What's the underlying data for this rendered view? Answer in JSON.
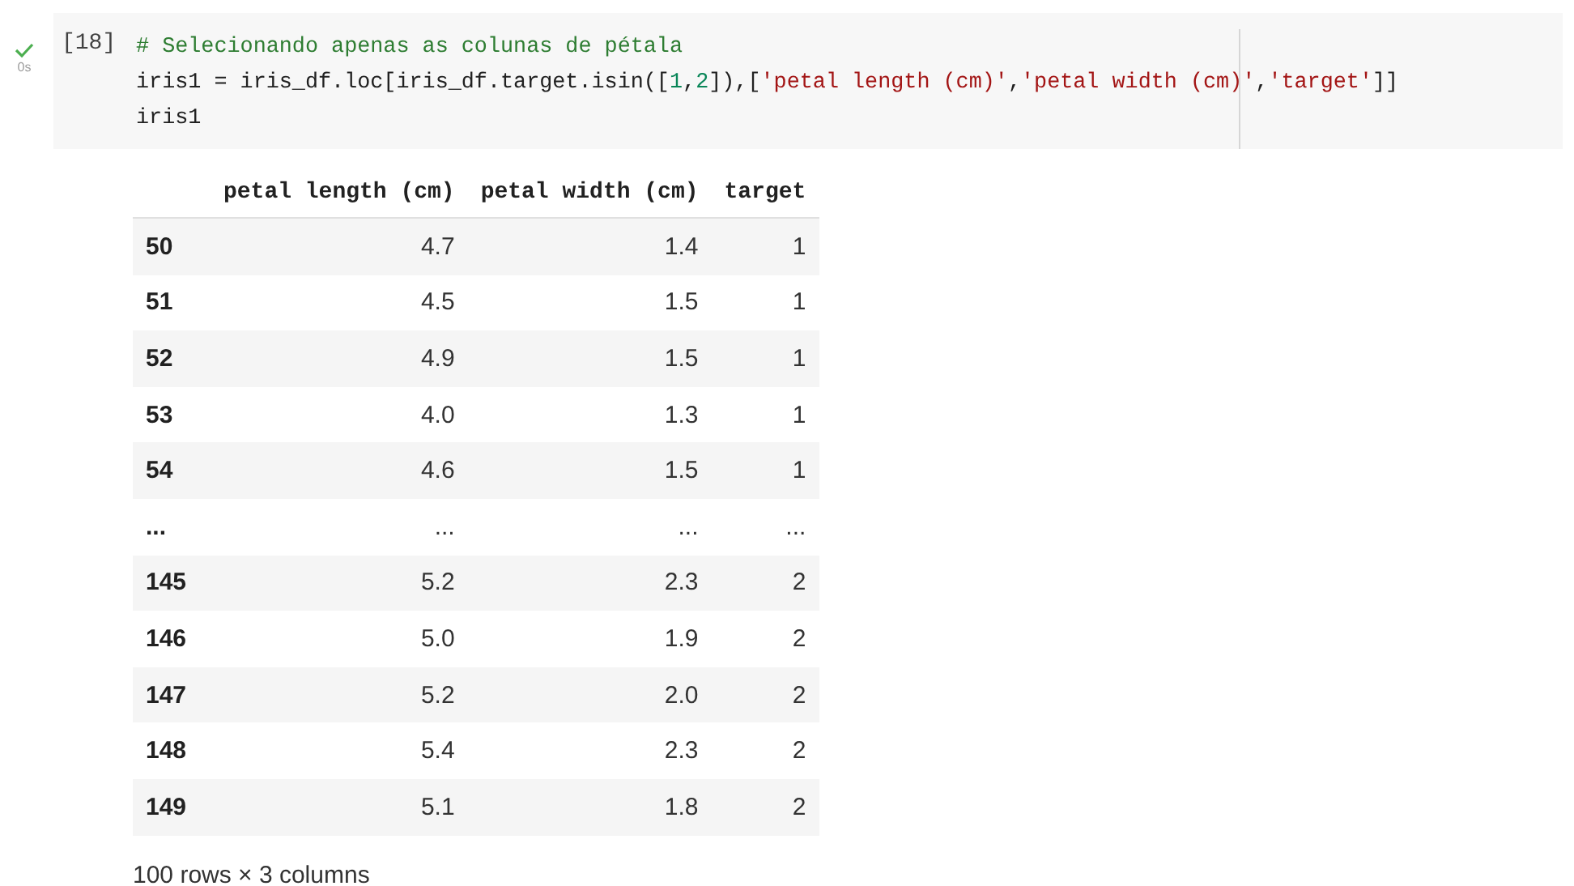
{
  "cell": {
    "succeeded": true,
    "time": "0s",
    "execution_count": "[18]",
    "code_lines": [
      [
        {
          "kind": "comment",
          "text": "# Selecionando apenas as colunas de pétala"
        }
      ],
      [
        {
          "kind": "plain",
          "text": "iris1 = iris_df.loc[iris_df.target.isin(["
        },
        {
          "kind": "number",
          "text": "1"
        },
        {
          "kind": "plain",
          "text": ","
        },
        {
          "kind": "number",
          "text": "2"
        },
        {
          "kind": "plain",
          "text": "]),["
        },
        {
          "kind": "string",
          "text": "'petal length (cm)'"
        },
        {
          "kind": "plain",
          "text": ","
        },
        {
          "kind": "string",
          "text": "'petal width (cm)'"
        },
        {
          "kind": "plain",
          "text": ","
        },
        {
          "kind": "string",
          "text": "'target'"
        },
        {
          "kind": "plain",
          "text": "]]"
        }
      ],
      [
        {
          "kind": "plain",
          "text": "iris1"
        }
      ]
    ]
  },
  "output_table": {
    "columns": [
      "petal length (cm)",
      "petal width (cm)",
      "target"
    ],
    "rows": [
      {
        "index": "50",
        "values": [
          "4.7",
          "1.4",
          "1"
        ]
      },
      {
        "index": "51",
        "values": [
          "4.5",
          "1.5",
          "1"
        ]
      },
      {
        "index": "52",
        "values": [
          "4.9",
          "1.5",
          "1"
        ]
      },
      {
        "index": "53",
        "values": [
          "4.0",
          "1.3",
          "1"
        ]
      },
      {
        "index": "54",
        "values": [
          "4.6",
          "1.5",
          "1"
        ]
      },
      {
        "index": "...",
        "values": [
          "...",
          "...",
          "..."
        ]
      },
      {
        "index": "145",
        "values": [
          "5.2",
          "2.3",
          "2"
        ]
      },
      {
        "index": "146",
        "values": [
          "5.0",
          "1.9",
          "2"
        ]
      },
      {
        "index": "147",
        "values": [
          "5.2",
          "2.0",
          "2"
        ]
      },
      {
        "index": "148",
        "values": [
          "5.4",
          "2.3",
          "2"
        ]
      },
      {
        "index": "149",
        "values": [
          "5.1",
          "1.8",
          "2"
        ]
      }
    ],
    "summary": "100 rows × 3 columns"
  }
}
